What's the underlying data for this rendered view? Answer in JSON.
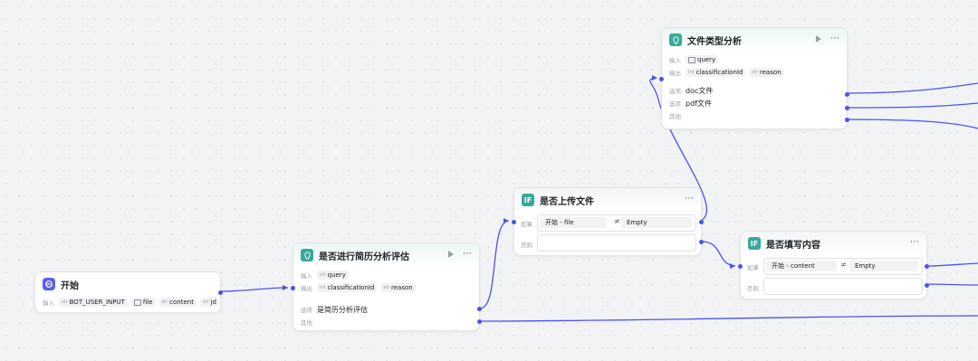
{
  "labels": {
    "input": "输入",
    "output": "输出",
    "option": "选项",
    "other": "其他",
    "if": "如果",
    "else": "否则"
  },
  "icons": {
    "more": "more-icon",
    "run": "run-icon"
  },
  "nodes": {
    "start": {
      "title": "开始",
      "icon": "start-icon",
      "inputs": [
        {
          "type": "str",
          "name": "BOT_USER_INPUT"
        },
        {
          "type": "file",
          "name": "file"
        },
        {
          "type": "str",
          "name": "content"
        },
        {
          "type": "str",
          "name": "jd"
        }
      ]
    },
    "resume_eval": {
      "title": "是否进行简历分析评估",
      "icon": "intent-icon",
      "inputs": [
        {
          "type": "str",
          "name": "query"
        }
      ],
      "outputs": [
        {
          "type": "Int",
          "name": "classificationId"
        },
        {
          "type": "str",
          "name": "reason"
        }
      ],
      "options": [
        "是简历分析评估"
      ]
    },
    "upload_check": {
      "title": "是否上传文件",
      "icon": "if-icon",
      "condition": {
        "left": "开始 - file",
        "op": "≠",
        "right": "Empty"
      }
    },
    "file_type": {
      "title": "文件类型分析",
      "icon": "intent-icon",
      "inputs": [
        {
          "type": "file",
          "name": "query"
        }
      ],
      "outputs": [
        {
          "type": "Int",
          "name": "classificationId"
        },
        {
          "type": "str",
          "name": "reason"
        }
      ],
      "options": [
        "doc文件",
        "pdf文件"
      ]
    },
    "content_check": {
      "title": "是否填写内容",
      "icon": "if-icon",
      "condition": {
        "left": "开始 - content",
        "op": "≠",
        "right": "Empty"
      }
    }
  },
  "colors": {
    "edge": "#4d53e8",
    "intent": "#3aa89b",
    "start": "#5c5ee8"
  }
}
